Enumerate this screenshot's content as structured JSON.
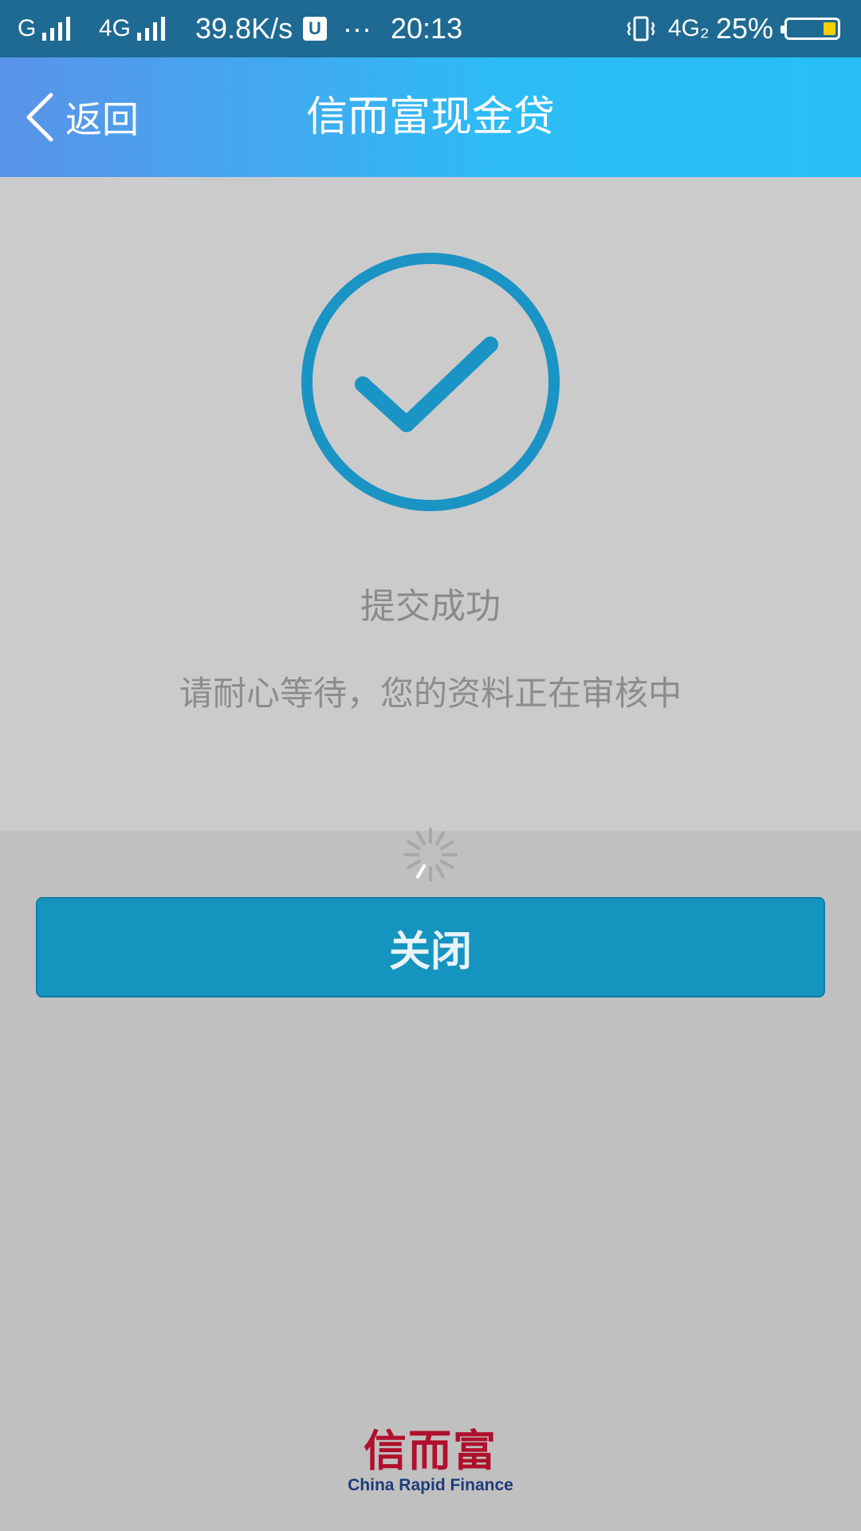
{
  "status_bar": {
    "network1": "G",
    "network2": "4G",
    "speed": "39.8K/s",
    "dots": "···",
    "time": "20:13",
    "network3": "4G₂",
    "battery": "25%",
    "battery_level": 0.25,
    "colors": {
      "background": "#1e6a92",
      "battery_fill": "#f5d000"
    }
  },
  "nav": {
    "back_label": "返回",
    "title": "信而富现金贷"
  },
  "content": {
    "success_title": "提交成功",
    "success_desc": "请耐心等待，您的资料正在审核中",
    "close_label": "关闭",
    "colors": {
      "accent": "#1594c0",
      "icon": "#1a94c4"
    }
  },
  "footer": {
    "logo_cn": "信而富",
    "logo_en": "China Rapid Finance"
  }
}
